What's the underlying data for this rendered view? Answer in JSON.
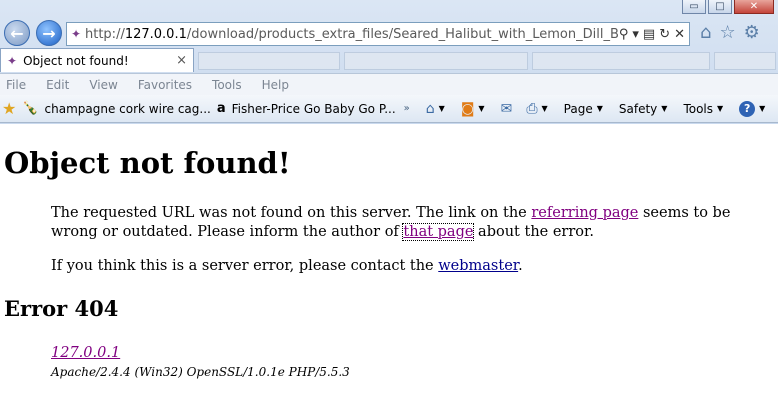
{
  "window": {
    "controls": {
      "minimize": "▭",
      "restore": "□",
      "close": "✕"
    }
  },
  "navigation": {
    "back_icon": "arrow-left-icon",
    "forward_icon": "arrow-right-icon"
  },
  "address_bar": {
    "scheme": "http://",
    "host": "127.0.0.1",
    "path": "/download/products_extra_files/Seared_Halibut_with_Lemon_Dill_Beurre_Blanc.pd"
  },
  "tab": {
    "title": "Object not found!",
    "close": "×"
  },
  "menu": [
    "File",
    "Edit",
    "View",
    "Favorites",
    "Tools",
    "Help"
  ],
  "favorites": [
    {
      "label": "champagne cork wire cag...",
      "icon": "bottle-icon"
    },
    {
      "label": "Fisher-Price Go Baby Go P...",
      "icon": "amazon-icon"
    }
  ],
  "command_bar": {
    "more": "»",
    "page": "Page",
    "safety": "Safety",
    "tools": "Tools",
    "help": "?"
  },
  "page": {
    "heading": "Object not found!",
    "p1_part1": "The requested URL was not found on this server. The link on the ",
    "p1_link1": "referring page",
    "p1_part2": " seems to be wrong or outdated. Please inform the author of ",
    "p1_link2": "that page",
    "p1_part3": " about the error.",
    "p2_part1": "If you think this is a server error, please contact the ",
    "p2_link": "webmaster",
    "p2_part2": ".",
    "error_heading": "Error 404",
    "address_link": "127.0.0.1",
    "server_signature": "Apache/2.4.4 (Win32) OpenSSL/1.0.1e PHP/5.5.3"
  }
}
